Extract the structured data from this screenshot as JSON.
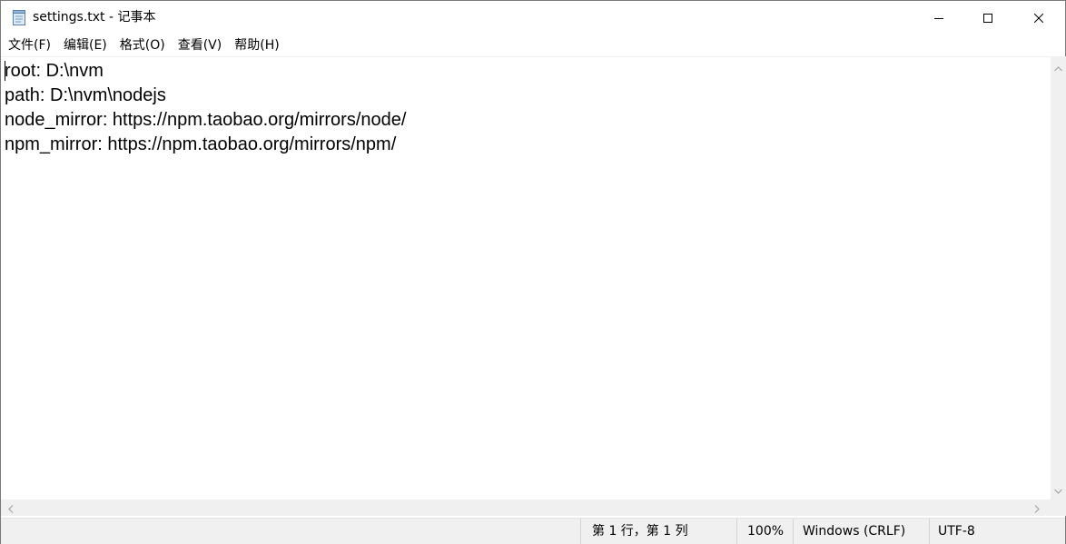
{
  "window": {
    "title": "settings.txt - 记事本",
    "app_icon": "notepad-icon",
    "controls": {
      "minimize": "minimize-icon",
      "maximize": "maximize-icon",
      "close": "close-icon"
    }
  },
  "menu": {
    "items": [
      {
        "label": "文件(F)"
      },
      {
        "label": "编辑(E)"
      },
      {
        "label": "格式(O)"
      },
      {
        "label": "查看(V)"
      },
      {
        "label": "帮助(H)"
      }
    ]
  },
  "editor": {
    "lines": [
      "root: D:\\nvm",
      "path: D:\\nvm\\nodejs",
      "node_mirror: https://npm.taobao.org/mirrors/node/",
      "npm_mirror: https://npm.taobao.org/mirrors/npm/"
    ]
  },
  "scrollbars": {
    "up": "scroll-up-icon",
    "down": "scroll-down-icon",
    "left": "scroll-left-icon",
    "right": "scroll-right-icon"
  },
  "status": {
    "position": "第 1 行，第 1 列",
    "zoom": "100%",
    "line_ending": "Windows (CRLF)",
    "encoding": "UTF-8"
  }
}
